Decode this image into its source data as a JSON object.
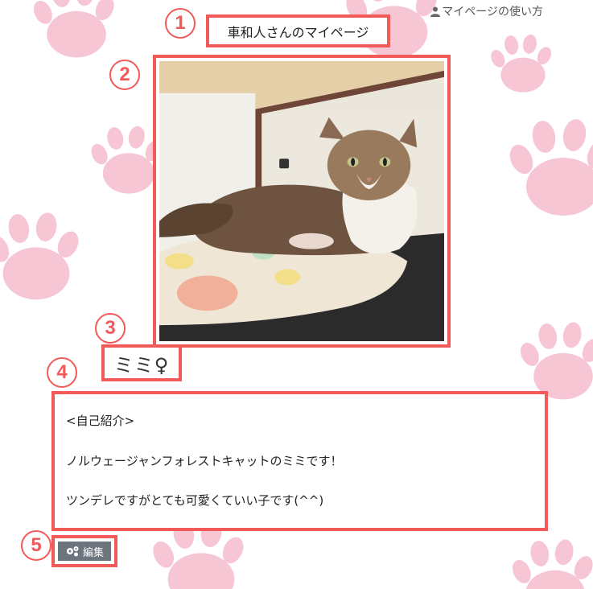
{
  "header": {
    "help_link": "マイページの使い方",
    "help_icon": "user-icon",
    "page_title": "車和人さんのマイページ"
  },
  "markers": [
    "1",
    "2",
    "3",
    "4",
    "5"
  ],
  "pet": {
    "name": "ミミ♀",
    "photo_subject": "cat"
  },
  "intro": {
    "lines": [
      "<自己紹介>",
      "ノルウェージャンフォレストキャットのミミです！",
      "ツンデレですがとても可愛くていい子です(^^)"
    ]
  },
  "actions": {
    "edit_label": "編集",
    "edit_icon": "gears-icon"
  },
  "colors": {
    "highlight": "#f25a5a",
    "paw": "#f6c6d4",
    "edit_button": "#6c757d"
  }
}
